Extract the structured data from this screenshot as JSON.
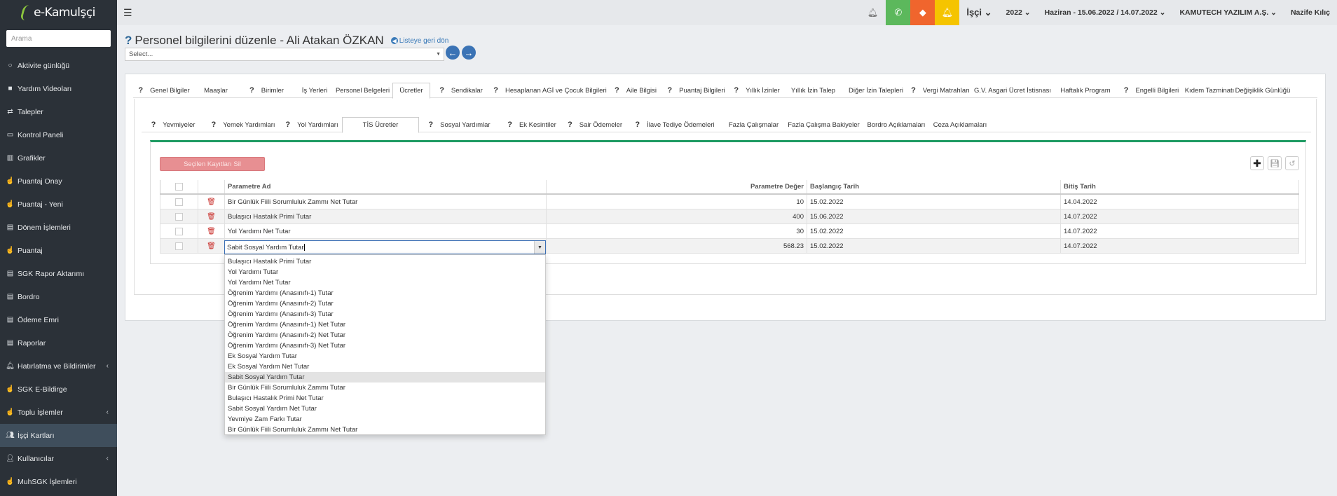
{
  "brand": {
    "name": "e-Kamulşçi"
  },
  "search": {
    "placeholder": "Arama"
  },
  "sidebar": {
    "items": [
      {
        "label": "Aktivite günlüğü",
        "icon": "circle-icon"
      },
      {
        "label": "Yardım Videoları",
        "icon": "video-icon"
      },
      {
        "label": "Talepler",
        "icon": "exchange-icon"
      },
      {
        "label": "Kontrol Paneli",
        "icon": "monitor-icon"
      },
      {
        "label": "Grafikler",
        "icon": "bar-chart-icon"
      },
      {
        "label": "Puantaj Onay",
        "icon": "hand-pointer-icon"
      },
      {
        "label": "Puantaj - Yeni",
        "icon": "hand-pointer-icon"
      },
      {
        "label": "Dönem İşlemleri",
        "icon": "document-icon"
      },
      {
        "label": "Puantaj",
        "icon": "hand-pointer-icon"
      },
      {
        "label": "SGK Rapor Aktarımı",
        "icon": "document-icon"
      },
      {
        "label": "Bordro",
        "icon": "document-icon"
      },
      {
        "label": "Ödeme Emri",
        "icon": "document-icon"
      },
      {
        "label": "Raporlar",
        "icon": "document-icon"
      },
      {
        "label": "Hatırlatma ve Bildirimler",
        "icon": "bell-icon"
      },
      {
        "label": "SGK E-Bildirge",
        "icon": "hand-pointer-icon"
      },
      {
        "label": "Toplu İşlemler",
        "icon": "hand-pointer-icon"
      },
      {
        "label": "İşçi Kartları",
        "icon": "users-icon"
      },
      {
        "label": "Kullanıcılar",
        "icon": "user-icon"
      },
      {
        "label": "MuhSGK İşlemleri",
        "icon": "hand-pointer-icon"
      }
    ]
  },
  "topbar": {
    "user_type": "İşçi",
    "year": "2022",
    "period": "Haziran - 15.06.2022 / 14.07.2022",
    "company": "KAMUTECH YAZILIM A.Ş.",
    "user": "Nazife Kılıç",
    "colors": {
      "phone": "#5cb85c",
      "ticket": "#f0652d",
      "bell": "#f5c400"
    }
  },
  "page": {
    "title": "Personel bilgilerini düzenle - Ali Atakan ÖZKAN",
    "back_label": "Listeye geri dön",
    "select_placeholder": "Select..."
  },
  "tabs_main": [
    {
      "label": "Genel Bilgiler",
      "help": true
    },
    {
      "label": "Maaşlar",
      "help": false
    },
    {
      "label": "Birimler",
      "help": true
    },
    {
      "label": "İş Yerleri",
      "help": false
    },
    {
      "label": "Personel Belgeleri",
      "help": false
    },
    {
      "label": "Ücretler",
      "help": false,
      "active": true
    },
    {
      "label": "Sendikalar",
      "help": true
    },
    {
      "label": "Hesaplanan AGİ ve Çocuk Bilgileri",
      "help": true
    },
    {
      "label": "Aile Bilgisi",
      "help": true
    },
    {
      "label": "Puantaj Bilgileri",
      "help": true
    },
    {
      "label": "Yıllık İzinler",
      "help": true
    },
    {
      "label": "Yıllık İzin Talep",
      "help": false
    },
    {
      "label": "Diğer İzin Talepleri",
      "help": false
    },
    {
      "label": "Vergi Matrahları",
      "help": true
    },
    {
      "label": "G.V. Asgari Ücret İstisnası",
      "help": false
    },
    {
      "label": "Haftalık Program",
      "help": false
    },
    {
      "label": "Engelli Bilgileri",
      "help": true
    },
    {
      "label": "Kıdem Tazminatı",
      "help": false
    },
    {
      "label": "Değişiklik Günlüğü",
      "help": false
    }
  ],
  "tabs_sub": [
    {
      "label": "Yevmiyeler",
      "help": true
    },
    {
      "label": "Yemek Yardımları",
      "help": true
    },
    {
      "label": "Yol Yardımları",
      "help": true
    },
    {
      "label": "TİS Ücretler",
      "help": false,
      "active": true
    },
    {
      "label": "Sosyal Yardımlar",
      "help": true
    },
    {
      "label": "Ek Kesintiler",
      "help": true
    },
    {
      "label": "Sair Ödemeler",
      "help": true
    },
    {
      "label": "İlave Tediye Ödemeleri",
      "help": true
    },
    {
      "label": "Fazla Çalışmalar",
      "help": false
    },
    {
      "label": "Fazla Çalışma Bakiyeler",
      "help": false
    },
    {
      "label": "Bordro Açıklamaları",
      "help": false
    },
    {
      "label": "Ceza Açıklamaları",
      "help": false
    }
  ],
  "grid": {
    "delete_selected": "Seçilen Kayıtları Sil",
    "headers": {
      "param": "Parametre Ad",
      "value": "Parametre Değer",
      "start": "Başlangıç Tarih",
      "end": "Bitiş Tarih"
    },
    "rows": [
      {
        "param": "Bir Günlük Fiili Sorumluluk Zammı Net Tutar",
        "value": "10",
        "start": "15.02.2022",
        "end": "14.04.2022"
      },
      {
        "param": "Bulaşıcı Hastalık Primi Tutar",
        "value": "400",
        "start": "15.06.2022",
        "end": "14.07.2022"
      },
      {
        "param": "Yol Yardımı Net Tutar",
        "value": "30",
        "start": "15.02.2022",
        "end": "14.07.2022"
      },
      {
        "param": "Sabit Sosyal Yardım Tutar",
        "value": "568.23",
        "start": "15.02.2022",
        "end": "14.07.2022",
        "editing": true
      }
    ]
  },
  "dropdown": {
    "options": [
      "Bulaşıcı Hastalık Primi Tutar",
      "Yol Yardımı Tutar",
      "Yol Yardımı Net Tutar",
      "Öğrenim Yardımı (Anasınıfı-1) Tutar",
      "Öğrenim Yardımı (Anasınıfı-2) Tutar",
      "Öğrenim Yardımı (Anasınıfı-3) Tutar",
      "Öğrenim Yardımı (Anasınıfı-1) Net Tutar",
      "Öğrenim Yardımı (Anasınıfı-2) Net Tutar",
      "Öğrenim Yardımı (Anasınıfı-3) Net Tutar",
      "Ek Sosyal Yardım Tutar",
      "Ek Sosyal Yardım Net Tutar",
      "Sabit Sosyal Yardım Tutar",
      "Bir Günlük Fiili Sorumluluk Zammı Tutar",
      "Bulaşıcı Hastalık Primi Net Tutar",
      "Sabit Sosyal Yardım Net Tutar",
      "Yevmiye Zam Farkı Tutar",
      "Bir Günlük Fiili Sorumluluk Zammı Net Tutar"
    ],
    "selected_index": 11
  }
}
